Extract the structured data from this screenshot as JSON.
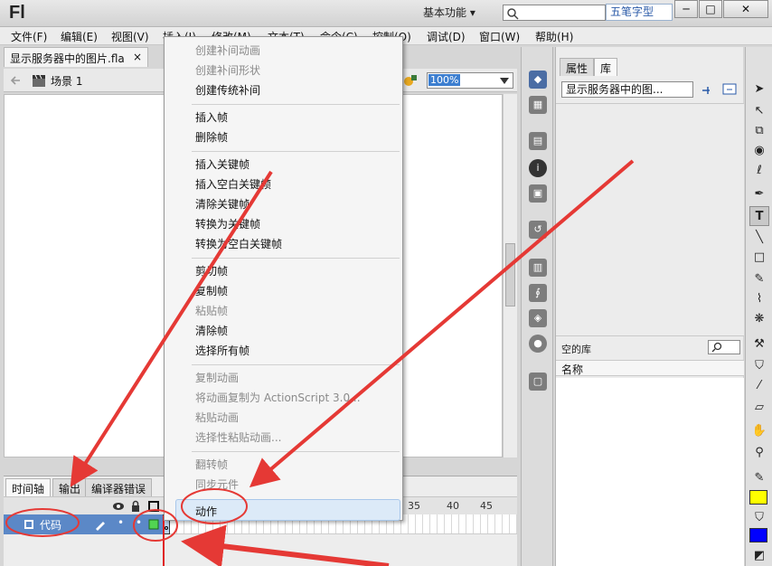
{
  "titlebar": {
    "logo": "Fl",
    "workspace": "基本功能",
    "workspace_caret": "▾",
    "ime_label": "五笔字型",
    "minimize": "─",
    "maximize": "□",
    "close": "✕"
  },
  "menubar": {
    "items": [
      "文件(F)",
      "编辑(E)",
      "视图(V)",
      "插入(I)",
      "修改(M)",
      "文本(T)",
      "命令(C)",
      "控制(O)",
      "调试(D)",
      "窗口(W)",
      "帮助(H)"
    ]
  },
  "document": {
    "tab_title": "显示服务器中的图片.fla",
    "tab_close": "×",
    "scene_label": "场景 1",
    "zoom": "100%"
  },
  "context_menu": {
    "items": [
      {
        "label": "创建补间动画",
        "disabled": true
      },
      {
        "label": "创建补间形状",
        "disabled": true
      },
      {
        "label": "创建传统补间",
        "disabled": false
      },
      {
        "label": "插入帧",
        "disabled": false
      },
      {
        "label": "删除帧",
        "disabled": false
      },
      {
        "label": "插入关键帧",
        "disabled": false
      },
      {
        "label": "插入空白关键帧",
        "disabled": false
      },
      {
        "label": "清除关键帧",
        "disabled": false
      },
      {
        "label": "转换为关键帧",
        "disabled": false
      },
      {
        "label": "转换为空白关键帧",
        "disabled": false
      },
      {
        "label": "剪切帧",
        "disabled": false
      },
      {
        "label": "复制帧",
        "disabled": false
      },
      {
        "label": "粘贴帧",
        "disabled": true
      },
      {
        "label": "清除帧",
        "disabled": false
      },
      {
        "label": "选择所有帧",
        "disabled": false
      },
      {
        "label": "复制动画",
        "disabled": true
      },
      {
        "label": "将动画复制为 ActionScript 3.0...",
        "disabled": true
      },
      {
        "label": "粘贴动画",
        "disabled": true
      },
      {
        "label": "选择性粘贴动画...",
        "disabled": true
      },
      {
        "label": "翻转帧",
        "disabled": true
      },
      {
        "label": "同步元件",
        "disabled": true
      },
      {
        "label": "动作",
        "disabled": false,
        "highlighted": true
      }
    ]
  },
  "timeline": {
    "tabs": [
      "时间轴",
      "输出",
      "编译器错误"
    ],
    "frame_numbers": [
      "35",
      "40",
      "45"
    ],
    "layer_name": "代码"
  },
  "library": {
    "tabs": [
      "属性",
      "库"
    ],
    "document_select": "显示服务器中的图...",
    "empty_label": "空的库",
    "name_column": "名称"
  },
  "colors": {
    "annotation_red": "#e53935",
    "selection_blue": "#5b88c7",
    "stroke_color": "#ffff00",
    "fill_color": "#0000ff"
  }
}
